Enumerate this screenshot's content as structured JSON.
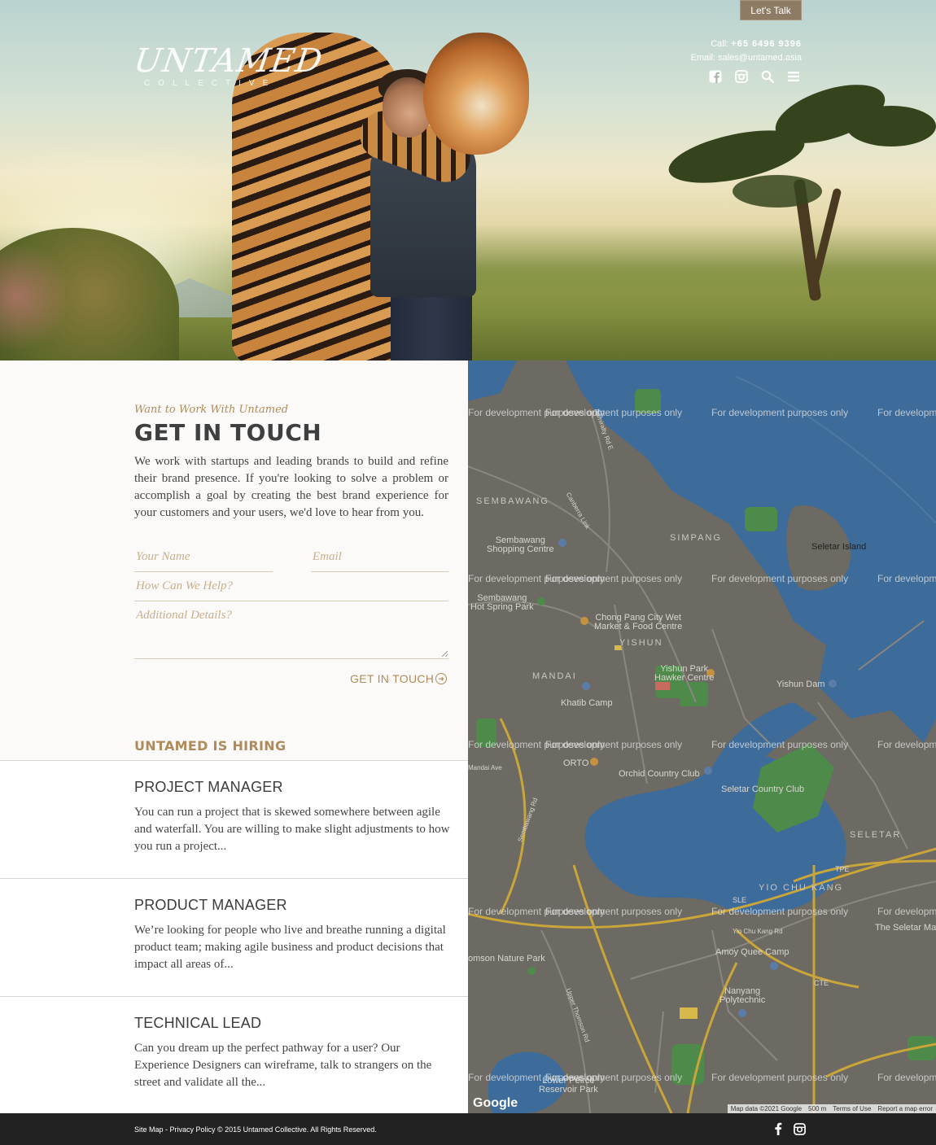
{
  "header": {
    "cta_label": "Let's Talk",
    "logo": {
      "main": "UNTAMED",
      "sub": "COLLECTIVE"
    },
    "contact": {
      "call_prefix": "Call:",
      "phone": "+65 6496 9396",
      "email_prefix": "Email:",
      "email": "sales@untamed.asia"
    },
    "icons": [
      "facebook-icon",
      "instagram-icon",
      "search-icon",
      "menu-icon"
    ]
  },
  "contact_section": {
    "eyebrow": "Want to Work With Untamed",
    "title": "GET IN TOUCH",
    "intro": "We work with startups and leading brands to build and refine their brand presence. If you're looking to solve a problem or accomplish a goal by creating the best brand experience for your customers and your users, we'd love to hear from you.",
    "form": {
      "name_placeholder": "Your Name",
      "email_placeholder": "Email",
      "help_placeholder": "How Can We Help?",
      "details_placeholder": "Additional Details?",
      "submit_label": "GET IN TOUCH"
    }
  },
  "hiring": {
    "title": "UNTAMED IS HIRING",
    "jobs": [
      {
        "title": "PROJECT MANAGER",
        "desc": "You can run a project that is skewed somewhere between agile and waterfall. You are willing to make slight adjustments to how you run a project..."
      },
      {
        "title": "PRODUCT MANAGER",
        "desc": "We’re looking for people who live and breathe running a digital product team; making agile business and product decisions that impact all areas of..."
      },
      {
        "title": "TECHNICAL LEAD",
        "desc": "Can you dream up the perfect pathway for a user? Our Experience Designers can wireframe, talk to strangers on the street and validate all the..."
      }
    ]
  },
  "map": {
    "watermark": "For development purposes only",
    "places": {
      "sembawang": "SEMBAWANG",
      "simpang": "SIMPANG",
      "seletar_island": "Seletar Island",
      "sembawang_shopping": "Sembawang\nShopping Centre",
      "sembawang_spring": "Sembawang\nHot Spring Park",
      "chong_pang": "Chong Pang City Wet\nMarket & Food Centre",
      "yishun": "YISHUN",
      "mandai": "MANDAI",
      "yishun_park": "Yishun Park\nHawker Centre",
      "yishun_dam": "Yishun Dam",
      "khatib": "Khatib Camp",
      "orto": "ORTO",
      "orchid": "Orchid Country Club",
      "seletar_cc": "Seletar Country Club",
      "seletar": "SELETAR",
      "yio_chu_kang": "YIO CHU KANG",
      "amoy": "Amoy Quee Camp",
      "nanyang": "Nanyang\nPolytechnic",
      "thomson": "omson Nature Park",
      "lower_peirce": "Lower Peirce\nReservoir Park",
      "the_seletar": "The Seletar Ma",
      "sle": "SLE",
      "tpe": "TPE",
      "cte": "CTE",
      "admiralty": "Admiralty Rd E",
      "canberra": "Canberra Link",
      "yio_chu_kang_rd": "Yio Chu Kang Rd",
      "mandai_ave": "Mandai Ave",
      "sembawang_rd": "Sembawang Rd",
      "upper_thomson": "Upper Thomson Rd"
    },
    "google": "Google",
    "attribution": {
      "data": "Map data ©2021 Google",
      "scale": "500 m",
      "terms": "Terms of Use",
      "report": "Report a map error"
    }
  },
  "footer": {
    "copy": "Site Map - Privacy Policy © 2015 Untamed Collective. All Rights Reserved.",
    "icons": [
      "facebook-icon",
      "instagram-icon"
    ]
  }
}
